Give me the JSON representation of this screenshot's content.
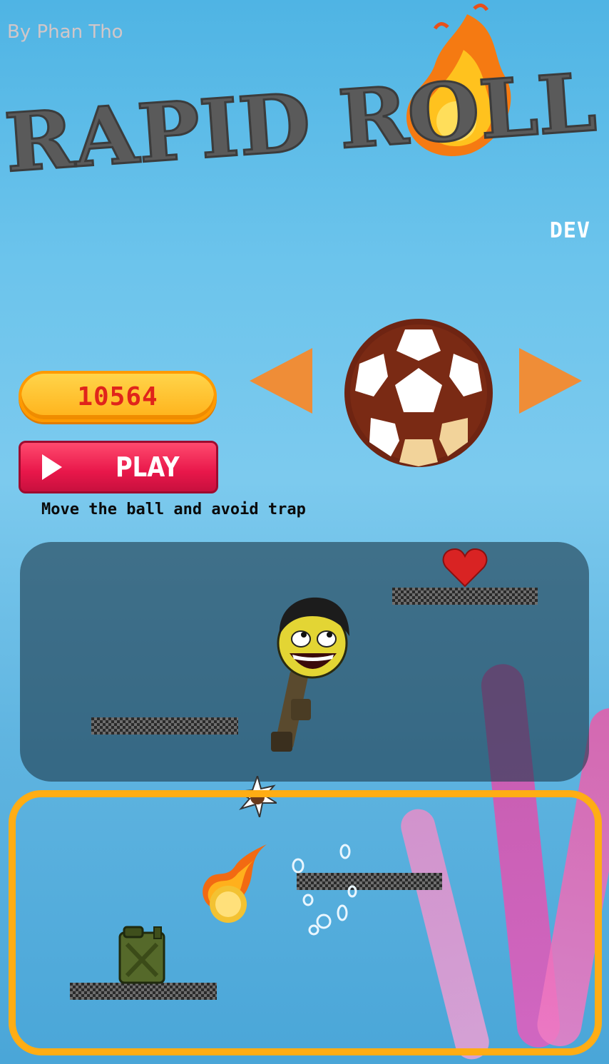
{
  "app": {
    "credit": "By Phan Tho",
    "title": "RAPID ROLL",
    "dev_label": "DEV"
  },
  "menu": {
    "high_score": "10564",
    "play_label": "PLAY",
    "hint": "Move the ball and avoid trap"
  },
  "ball_selector": {
    "current_ball": "soccer-ball",
    "prev_icon": "triangle-left-icon",
    "next_icon": "triangle-right-icon"
  },
  "colors": {
    "score_text": "#e0241b",
    "play_button": "#e8174a",
    "arrow": "#ef8d37",
    "highlight_frame": "#ffad14",
    "title_text": "#5a5a5a"
  },
  "demo": {
    "sprites": [
      "heart-icon",
      "awesome-face-with-bazooka",
      "spike-trap-icon",
      "fireball-icon",
      "fuel-can-icon"
    ]
  }
}
